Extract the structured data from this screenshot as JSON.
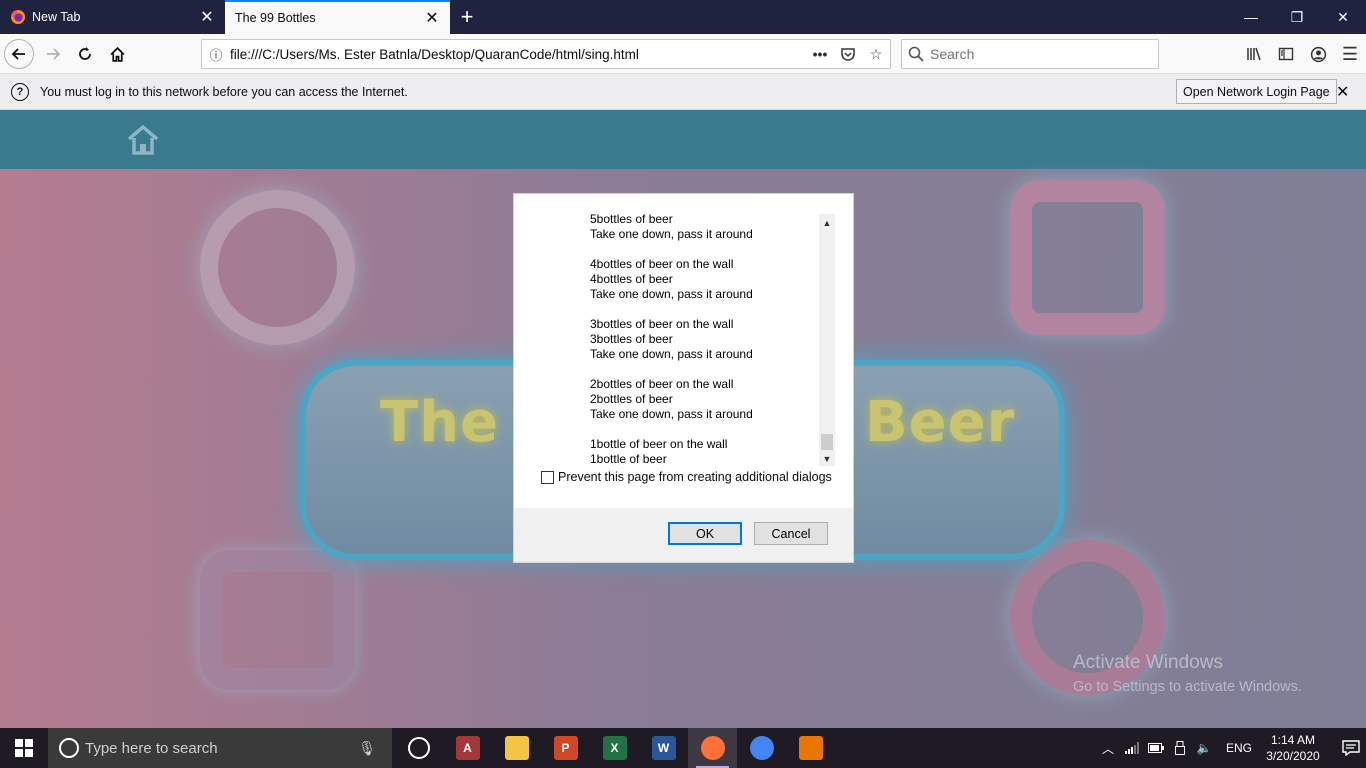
{
  "browser": {
    "tabs": [
      {
        "title": "New Tab",
        "active": false
      },
      {
        "title": "The 99 Bottles",
        "active": true
      }
    ],
    "url": "file:///C:/Users/Ms. Ester Batnla/Desktop/QuaranCode/html/sing.html",
    "search_placeholder": "Search"
  },
  "notification": {
    "message": "You must log in to this network before you can access the Internet.",
    "button_label": "Open Network Login Page"
  },
  "page": {
    "banner_title": "The 9",
    "banner_title_end": "Beer"
  },
  "dialog": {
    "lines": [
      "5bottles of beer",
      "Take one down, pass it around",
      "",
      "4bottles of beer on the wall",
      "4bottles of beer",
      "Take one down, pass it around",
      "",
      "3bottles of beer on the wall",
      "3bottles of beer",
      "Take one down, pass it around",
      "",
      "2bottles of beer on the wall",
      "2bottles of beer",
      "Take one down, pass it around",
      "",
      "1bottle of beer on the wall",
      "1bottle of beer"
    ],
    "prevent_label": "Prevent this page from creating additional dialogs",
    "prevent_checked": false,
    "ok_label": "OK",
    "cancel_label": "Cancel"
  },
  "watermark": {
    "line1": "Activate Windows",
    "line2": "Go to Settings to activate Windows."
  },
  "taskbar": {
    "search_placeholder": "Type here to search",
    "apps": [
      {
        "name": "task-view",
        "letter": "",
        "color": "#1f1b24"
      },
      {
        "name": "access",
        "letter": "A",
        "color": "#a4373a"
      },
      {
        "name": "file-explorer",
        "letter": "",
        "color": "#f4c542"
      },
      {
        "name": "powerpoint",
        "letter": "P",
        "color": "#d24726"
      },
      {
        "name": "excel",
        "letter": "X",
        "color": "#217346"
      },
      {
        "name": "word",
        "letter": "W",
        "color": "#2b579a"
      },
      {
        "name": "firefox",
        "letter": "",
        "color": "#ff7139"
      },
      {
        "name": "chrome",
        "letter": "",
        "color": "#4285f4"
      },
      {
        "name": "blender",
        "letter": "",
        "color": "#ea7600"
      }
    ],
    "language": "ENG",
    "time": "1:14 AM",
    "date": "3/20/2020"
  }
}
